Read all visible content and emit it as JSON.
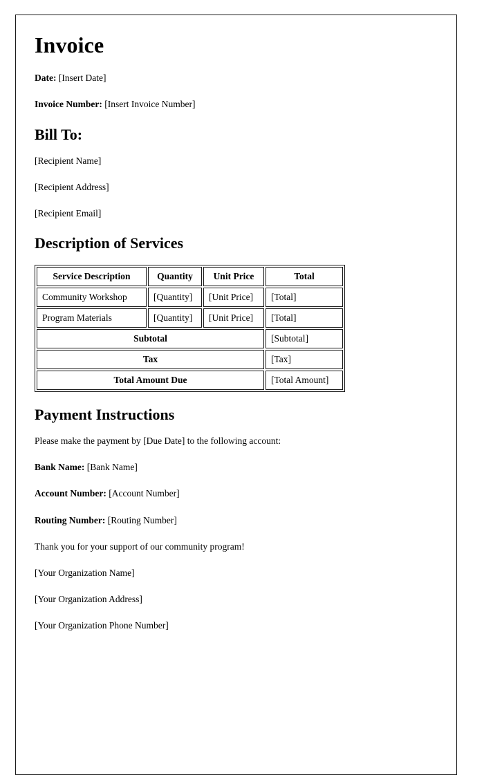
{
  "document": {
    "title": "Invoice",
    "meta": [
      {
        "label": "Date:",
        "value": "[Insert Date]"
      },
      {
        "label": "Invoice Number:",
        "value": "[Insert Invoice Number]"
      }
    ],
    "bill_to": {
      "heading": "Bill To:",
      "lines": [
        "[Recipient Name]",
        "[Recipient Address]",
        "[Recipient Email]"
      ]
    },
    "services": {
      "heading": "Description of Services",
      "columns": [
        "Service Description",
        "Quantity",
        "Unit Price",
        "Total"
      ],
      "rows": [
        {
          "description": "Community Workshop",
          "quantity": "[Quantity]",
          "unit_price": "[Unit Price]",
          "total": "[Total]"
        },
        {
          "description": "Program Materials",
          "quantity": "[Quantity]",
          "unit_price": "[Unit Price]",
          "total": "[Total]"
        }
      ],
      "summary": [
        {
          "label": "Subtotal",
          "value": "[Subtotal]"
        },
        {
          "label": "Tax",
          "value": "[Tax]"
        },
        {
          "label": "Total Amount Due",
          "value": "[Total Amount]"
        }
      ]
    },
    "payment": {
      "heading": "Payment Instructions",
      "intro": "Please make the payment by [Due Date] to the following account:",
      "fields": [
        {
          "label": "Bank Name:",
          "value": "[Bank Name]"
        },
        {
          "label": "Account Number:",
          "value": "[Account Number]"
        },
        {
          "label": "Routing Number:",
          "value": "[Routing Number]"
        }
      ]
    },
    "closing": {
      "thanks": "Thank you for your support of our community program!",
      "lines": [
        "[Your Organization Name]",
        "[Your Organization Address]",
        "[Your Organization Phone Number]"
      ]
    }
  },
  "theme": {
    "text_color": "#000000",
    "page_background": "#ffffff",
    "border_color": "#1a1a1a"
  }
}
